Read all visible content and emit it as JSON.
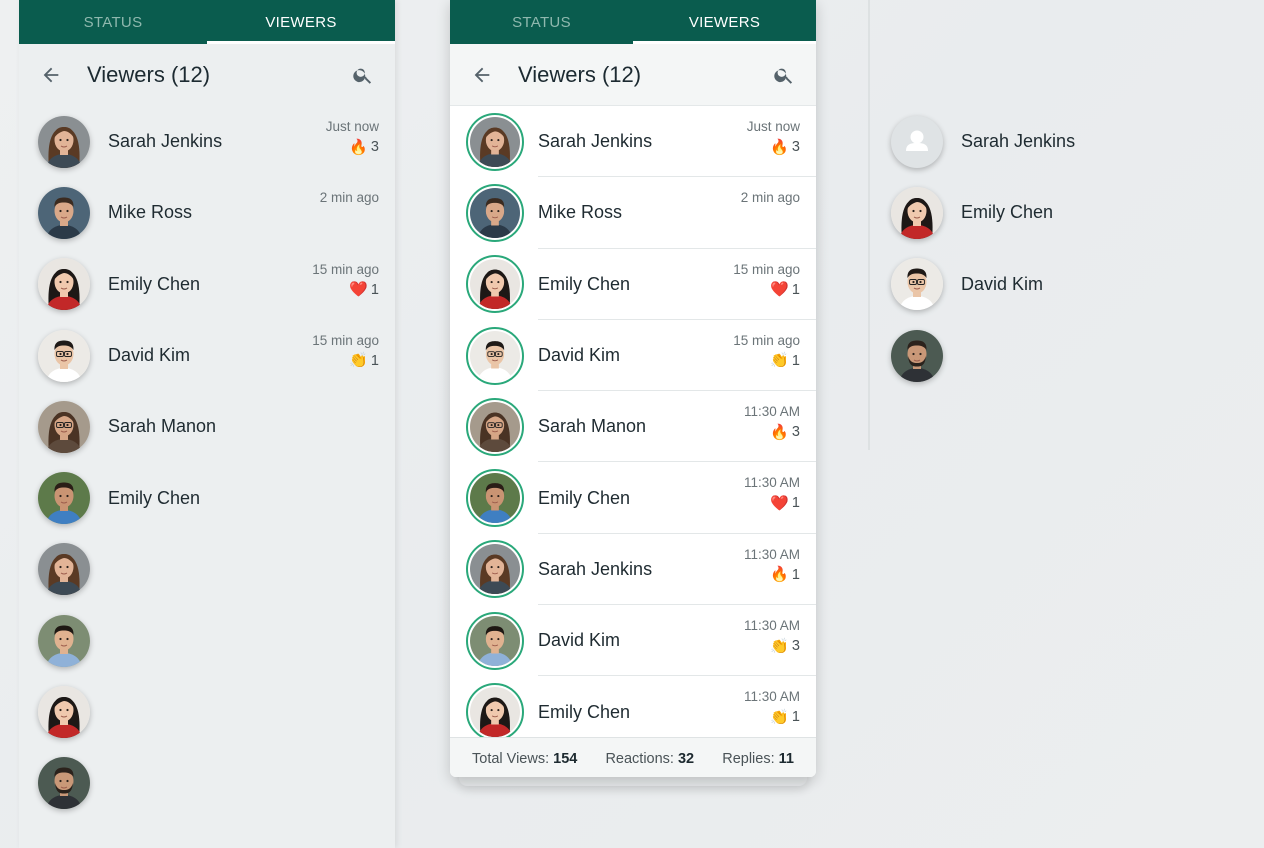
{
  "tabs": {
    "status": "STATUS",
    "viewers": "VIEWERS"
  },
  "header": {
    "title": "Viewers (12)"
  },
  "colors": {
    "brand": "#0a5c4e",
    "ring": "#2aa87a"
  },
  "panel1": {
    "rows": [
      {
        "name": "Sarah Jenkins",
        "time": "Just now",
        "emoji": "🔥",
        "count": "3",
        "avatar": "woman-brown"
      },
      {
        "name": "Mike Ross",
        "time": "2 min ago",
        "emoji": "",
        "count": "",
        "avatar": "man-brown"
      },
      {
        "name": "Emily Chen",
        "time": "15 min ago",
        "emoji": "❤️",
        "count": "1",
        "avatar": "woman-black"
      },
      {
        "name": "David Kim",
        "time": "15 min ago",
        "emoji": "👏",
        "count": "1",
        "avatar": "man-glasses"
      },
      {
        "name": "Sarah Manon",
        "time": "",
        "emoji": "",
        "count": "",
        "avatar": "woman-glasses"
      },
      {
        "name": "Emily Chen",
        "time": "",
        "emoji": "",
        "count": "",
        "avatar": "woman-outdoor"
      },
      {
        "name": "",
        "time": "",
        "emoji": "",
        "count": "",
        "avatar": "woman-brown"
      },
      {
        "name": "",
        "time": "",
        "emoji": "",
        "count": "",
        "avatar": "man-smile"
      },
      {
        "name": "",
        "time": "",
        "emoji": "",
        "count": "",
        "avatar": "woman-black"
      },
      {
        "name": "",
        "time": "",
        "emoji": "",
        "count": "",
        "avatar": "man-beard"
      }
    ]
  },
  "panel2": {
    "rows": [
      {
        "name": "Sarah Jenkins",
        "time": "Just now",
        "emoji": "🔥",
        "count": "3",
        "avatar": "woman-brown"
      },
      {
        "name": "Mike Ross",
        "time": "2 min ago",
        "emoji": "",
        "count": "",
        "avatar": "man-brown"
      },
      {
        "name": "Emily Chen",
        "time": "15 min ago",
        "emoji": "❤️",
        "count": "1",
        "avatar": "woman-black"
      },
      {
        "name": "David Kim",
        "time": "15 min ago",
        "emoji": "👏",
        "count": "1",
        "avatar": "man-glasses"
      },
      {
        "name": "Sarah Manon",
        "time": "11:30 AM",
        "emoji": "🔥",
        "count": "3",
        "avatar": "woman-glasses"
      },
      {
        "name": "Emily Chen",
        "time": "11:30 AM",
        "emoji": "❤️",
        "count": "1",
        "avatar": "woman-outdoor"
      },
      {
        "name": "Sarah Jenkins",
        "time": "11:30 AM",
        "emoji": "🔥",
        "count": "1",
        "avatar": "woman-brown"
      },
      {
        "name": "David Kim",
        "time": "11:30 AM",
        "emoji": "👏",
        "count": "3",
        "avatar": "man-smile"
      },
      {
        "name": "Emily Chen",
        "time": "11:30 AM",
        "emoji": "👏",
        "count": "1",
        "avatar": "woman-black"
      }
    ],
    "footer": {
      "total_label": "Total Views:",
      "total_value": "154",
      "reactions_label": "Reactions:",
      "reactions_value": "32",
      "replies_label": "Replies:",
      "replies_value": "11"
    }
  },
  "panel3": {
    "rows": [
      {
        "name": "Sarah Jenkins",
        "avatar": "placeholder"
      },
      {
        "name": "Emily Chen",
        "avatar": "woman-black"
      },
      {
        "name": "David Kim",
        "avatar": "man-glasses"
      },
      {
        "name": "",
        "avatar": "man-beard"
      }
    ]
  }
}
